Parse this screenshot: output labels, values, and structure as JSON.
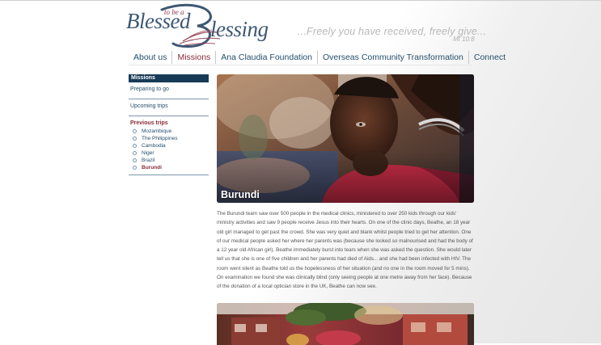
{
  "logo": {
    "small": "to be a",
    "word1": "Blessed",
    "word2": "lessing"
  },
  "header": {
    "tagline": "...Freely you have received, freely give...",
    "verse": "Mt 10:8"
  },
  "nav": {
    "items": [
      {
        "label": "About us"
      },
      {
        "label": "Missions"
      },
      {
        "label": "Ana Claudia Foundation"
      },
      {
        "label": "Overseas Community Transformation"
      },
      {
        "label": "Connect"
      }
    ],
    "active": "Missions"
  },
  "sidebar": {
    "heading": "Missions",
    "links": [
      "Preparing to go",
      "Upcoming trips"
    ],
    "previous_heading": "Previous trips",
    "trips": [
      "Mozambique",
      "The Philippines",
      "Cambodia",
      "Niger",
      "Brazil",
      "Burundi"
    ],
    "current_trip": "Burundi"
  },
  "main": {
    "hero_caption": "Burundi",
    "body": "The Burundi team saw over 500 people in the medical clinics, ministered to over 250 kids through our kids' ministry activities and saw 9 people receive Jesus into their hearts. On one of the clinic days, Beathe, an 18 year old girl managed to get past the crowd. She was very quiet and blank whilst people tried to get her attention. One of our medical people asked her where her parents was (because she looked so malnourised and had the body of a 12 year old African girl). Beathe immediately burst into tears when she was asked the question. She would later tell us that she is one of five children and her parents had died of Aids... and she had been infected with HIV. The room went silent as Beathe told us the hopelessness of her situation (and no one in the room moved for 5 mins). On examination we found she was clinically blind (only seeing people at one metre away from her face). Because of the donation of a local optician store in the UK, Beathe can now see."
  },
  "colors": {
    "navy": "#173b57",
    "link": "#244f6c",
    "accent": "#8a2a38"
  }
}
